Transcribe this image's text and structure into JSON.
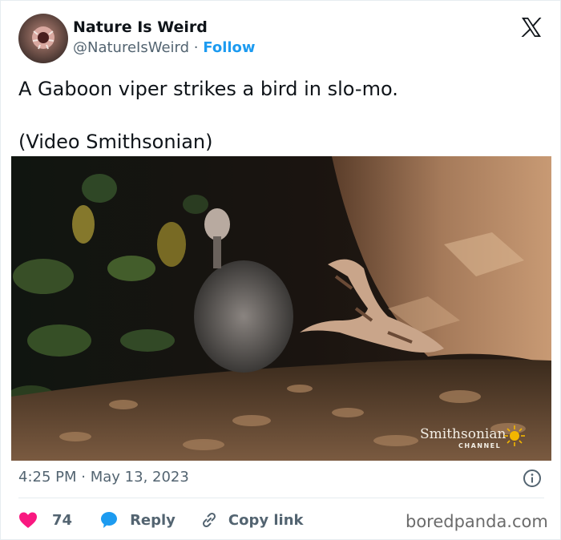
{
  "author": {
    "name": "Nature Is Weird",
    "handle": "@NatureIsWeird",
    "separator": "·",
    "follow_label": "Follow"
  },
  "tweet": {
    "line1": "A Gaboon viper strikes a bird in slo-mo.",
    "line2": "(Video Smithsonian)"
  },
  "video": {
    "channel_logo_line1": "Smithsonian",
    "channel_logo_line2": "CHANNEL"
  },
  "meta": {
    "time": "4:25 PM",
    "separator": "·",
    "date": "May 13, 2023"
  },
  "actions": {
    "likes_count": "74",
    "reply_label": "Reply",
    "copy_link_label": "Copy link"
  },
  "watermark": "boredpanda.com",
  "icons": {
    "platform": "x-logo-icon",
    "like": "heart-icon",
    "reply": "speech-bubble-icon",
    "copy": "link-icon",
    "info": "info-icon"
  },
  "colors": {
    "like": "#f91880",
    "reply": "#1d9bf0",
    "follow": "#1d9bf0",
    "muted": "#536471"
  }
}
